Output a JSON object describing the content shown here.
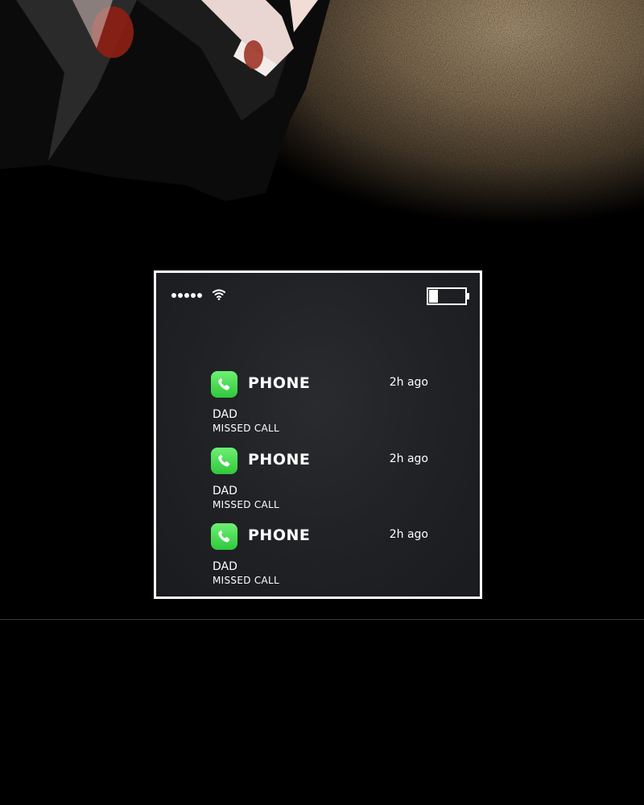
{
  "status_bar": {
    "signal_bars": 5,
    "wifi_icon": "wifi-icon",
    "battery_icon": "battery-low-icon",
    "battery_level_fraction": 0.25
  },
  "notifications": [
    {
      "app_icon": "phone-icon",
      "app_name": "PHONE",
      "time": "2h ago",
      "caller": "DAD",
      "status": "MISSED CALL"
    },
    {
      "app_icon": "phone-icon",
      "app_name": "PHONE",
      "time": "2h ago",
      "caller": "DAD",
      "status": "MISSED CALL"
    },
    {
      "app_icon": "phone-icon",
      "app_name": "PHONE",
      "time": "2h ago",
      "caller": "DAD",
      "status": "MISSED CALL"
    }
  ],
  "colors": {
    "phone_icon_green": "#3fd44a",
    "panel_background": "#202125",
    "panel_border": "#ffffff",
    "background_glow": "#a89274"
  }
}
